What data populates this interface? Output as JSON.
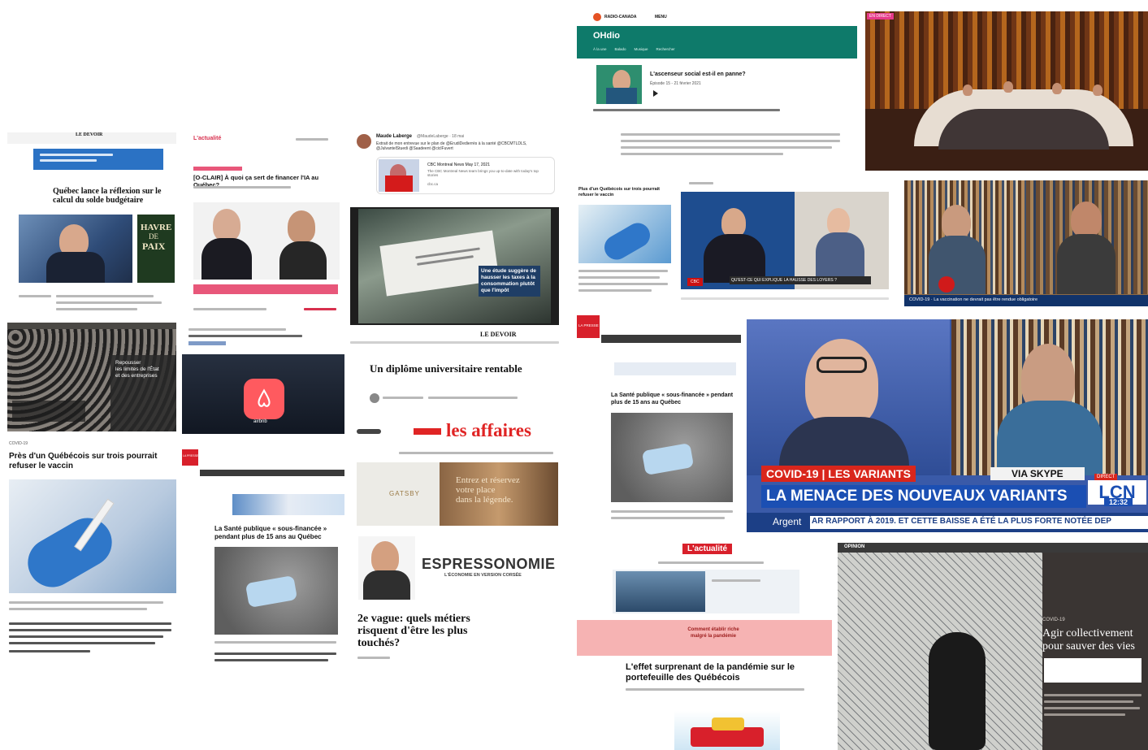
{
  "t1": {
    "masthead": "LE DEVOIR",
    "headline": "Québec lance la réflexion sur le calcul du solde budgétaire",
    "ad": [
      "HAVRE",
      "DE",
      "PAIX"
    ]
  },
  "t2": {
    "logo": "L'actualité",
    "headline": "[O-CLAIR] À quoi ça sert de financer l'IA au Québec?"
  },
  "t3": {
    "author": "Maude Laberge",
    "handle": "@MaudeLaberge · 18 mai",
    "text": "Extrait de mon entrevue sur le plan de @ErudiDedierrès à la santé @CBCMTLDLS, @JulvantelStuedi @Saadeent @ciclFuvert",
    "card_title": "CBC Montreal News May 17, 2021",
    "card_text": "The CBC Montreal News team brings you up-to-date with today's top stories",
    "card_domain": "cbc.ca"
  },
  "t4": {
    "caption": "Une étude suggère de hausser les taxes à la consommation plutôt que l'impôt"
  },
  "t5": {
    "caption": [
      "Repousser",
      "les limites de l'État",
      "et des entreprises"
    ]
  },
  "t6": {
    "logo": "airbnb"
  },
  "t7": {
    "masthead": "LE DEVOIR",
    "headline": "Un diplôme universitaire rentable"
  },
  "t8": {
    "logo": "les affaires",
    "ad": [
      "Entrez et réservez",
      "votre place",
      "dans la légende."
    ],
    "brand": "GATSBY"
  },
  "t9": {
    "title": "ESPRESSONOMIE",
    "subtitle": "L'ÉCONOMIE EN VERSION CORSÉE"
  },
  "t10": {
    "headline": "2e vague: quels métiers risquent d'être les plus touchés?"
  },
  "t11": {
    "kicker": "COVID-19",
    "headline": "Près d'un Québécois sur trois pourrait refuser le vaccin"
  },
  "t12": {
    "logo": "LA PRESSE",
    "headline": "La Santé publique « sous-financée » pendant plus de 15 ans au Québec"
  },
  "t13": {
    "brand": "RADIO-CANADA",
    "menu": "MENU",
    "app": "OHdio",
    "tabs": [
      "À la une",
      "Balado",
      "Musique",
      "Rechercher"
    ],
    "title": "L'ascenseur social est-il en panne?",
    "episode": "Épisode 15 - 21 février 2021"
  },
  "t14": {
    "live": "EN DIRECT"
  },
  "t15": {
    "headline": "Plus d'un Québécois sur trois pourrait refuser le vaccin"
  },
  "t16": {
    "chyron": "QU'EST-CE QUI EXPLIQUE LA HAUSSE DES LOYERS ?",
    "badge": "CBC"
  },
  "t17": {
    "ticker": "COVID-19 · La vaccination ne devrait pas être rendue obligatoire"
  },
  "t18": {
    "logo": "LA PRESSE",
    "headline": "La Santé publique « sous-financée » pendant plus de 15 ans au Québec"
  },
  "t19": {
    "topic": "COVID-19 | LES VARIANTS",
    "via": "VIA SKYPE",
    "headline": "LA MENACE DES NOUVEAUX VARIANTS",
    "network": "LCN",
    "time": "12:32",
    "live": "DIRECT",
    "ticker_label": "Argent",
    "ticker": "AR RAPPORT À 2019. ET CETTE BAISSE A ÉTÉ LA PLUS FORTE NOTÉE DEP"
  },
  "t20": {
    "logo": "L'actualité",
    "promo": [
      "Comment établir riche",
      "malgré la pandémie"
    ],
    "headline": "L'effet surprenant de la pandémie sur le portefeuille des Québécois"
  },
  "t21": {
    "label": "OPINION",
    "kicker": "COVID-19",
    "headline": "Agir collectivement pour sauver des vies"
  }
}
